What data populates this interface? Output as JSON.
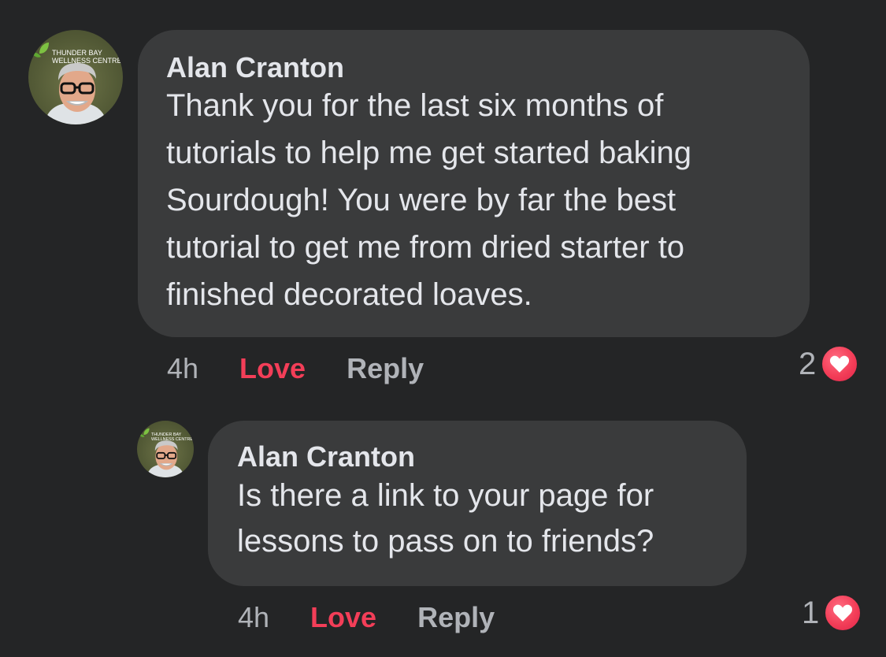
{
  "comments": [
    {
      "author": "Alan Cranton",
      "avatar_text_1": "THUNDER BAY",
      "avatar_text_2": "WELLNESS CENTRE",
      "text": "Thank you for the last six months of\ntutorials to help me get started baking\nSourdough! You were by far the best\ntutorial to get me from dried starter to\nfinished decorated loaves.",
      "time": "4h",
      "love_label": "Love",
      "reply_label": "Reply",
      "reaction_count": "2",
      "reaction_icon": "heart-icon"
    },
    {
      "author": "Alan Cranton",
      "avatar_text_1": "THUNDER BAY",
      "avatar_text_2": "WELLNESS CENTRE",
      "text": "Is there a link to your page for\nlessons to pass on to friends?",
      "time": "4h",
      "love_label": "Love",
      "reply_label": "Reply",
      "reaction_count": "1",
      "reaction_icon": "heart-icon"
    }
  ],
  "colors": {
    "background": "#242526",
    "bubble": "#3a3b3c",
    "text_primary": "#e4e6eb",
    "text_secondary": "#b0b3b8",
    "love_active": "#f33e58"
  }
}
